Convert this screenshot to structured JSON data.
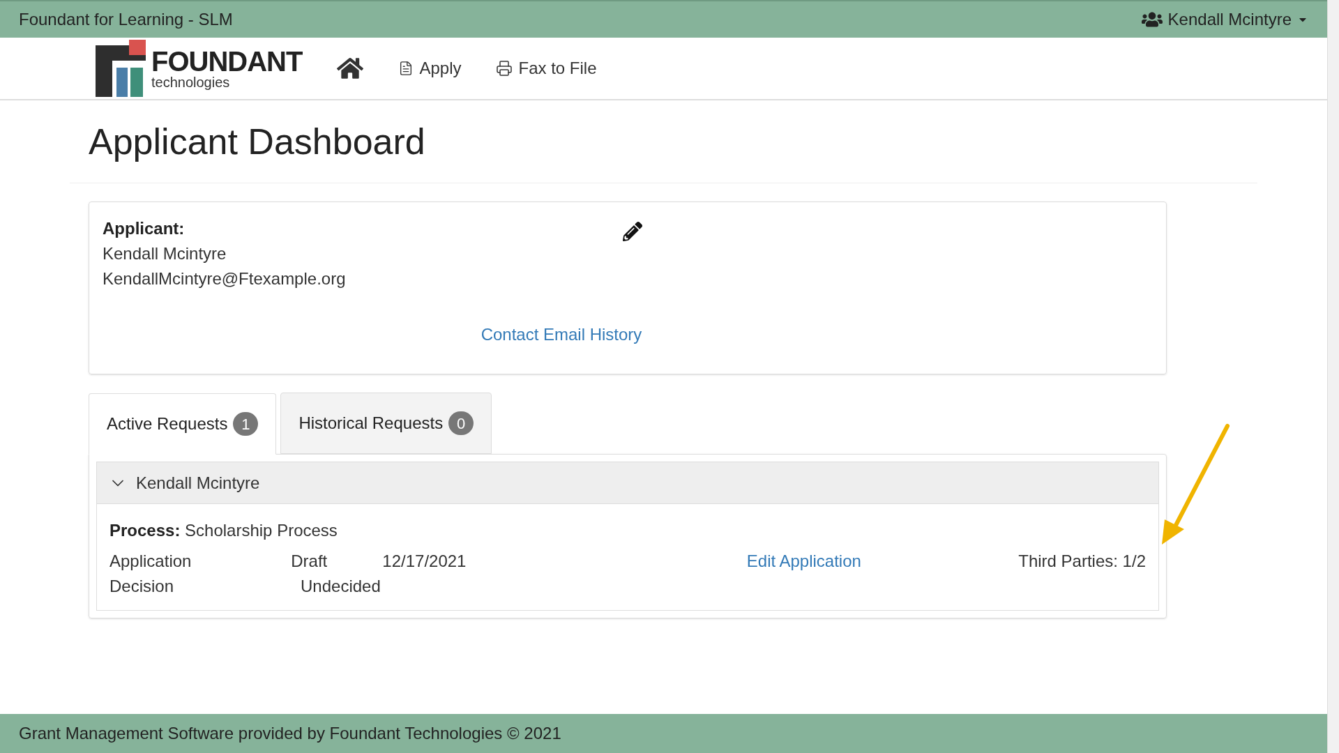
{
  "top_bar": {
    "title": "Foundant for Learning - SLM",
    "user_menu": "Kendall Mcintyre"
  },
  "nav": {
    "logo": {
      "name": "FOUNDANT",
      "tagline": "technologies"
    },
    "links": [
      {
        "kind": "home"
      },
      {
        "kind": "apply",
        "label": "Apply"
      },
      {
        "kind": "fax",
        "label": "Fax to File"
      }
    ]
  },
  "page_title": "Applicant Dashboard",
  "applicant": {
    "heading": "Applicant:",
    "name": "Kendall Mcintyre",
    "email": "KendallMcintyre@Ftexample.org",
    "link": "Contact Email History"
  },
  "tabs": [
    {
      "label": "Active Requests",
      "count": "1",
      "selected": true
    },
    {
      "label": "Historical Requests",
      "count": "0",
      "selected": false
    }
  ],
  "request": {
    "name": "Kendall Mcintyre",
    "expanded": true,
    "process_label": "Process:",
    "process": "Scholarship Process",
    "rows": [
      {
        "cells": [
          "Application",
          "Draft",
          "12/17/2021"
        ],
        "link": "Edit Application",
        "note": "Third Parties: 1/2"
      },
      {
        "cells": [
          "Decision",
          "Undecided"
        ]
      }
    ]
  },
  "footer": "Grant Management Software provided by Foundant Technologies © 2021"
}
